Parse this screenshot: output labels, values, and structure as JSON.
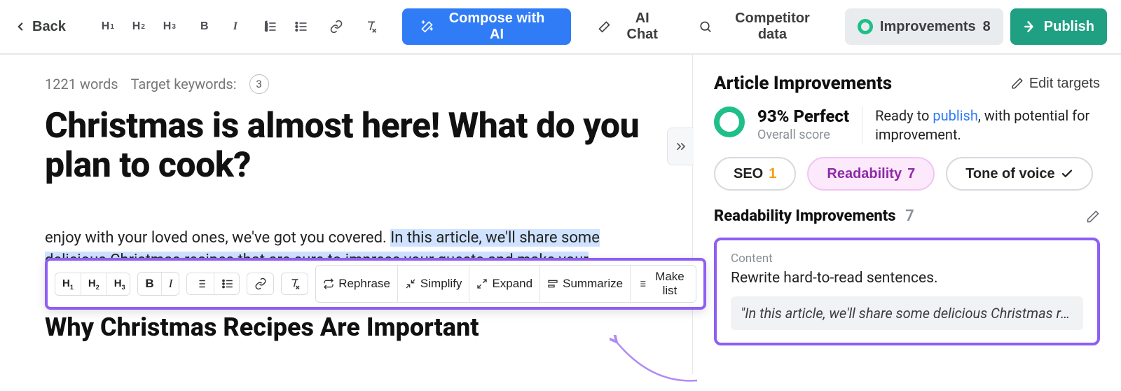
{
  "topbar": {
    "back": "Back",
    "compose": "Compose with AI",
    "ai_chat": "AI Chat",
    "competitor": "Competitor data",
    "improvements": "Improvements",
    "improvements_count": "8",
    "publish": "Publish"
  },
  "editor": {
    "words_label": "1221 words",
    "target_keywords_label": "Target keywords:",
    "target_keywords_count": "3",
    "title": "Christmas is almost here! What do you plan to cook?",
    "para_prefix": "enjoy with your loved ones, we've got you covered. ",
    "para_highlight": "In this article, we'll share some delicious Christmas recipes that are sure to impress your guests and make your holiday season even more special.",
    "h2": "Why Christmas Recipes Are Important"
  },
  "float_toolbar": {
    "rephrase": "Rephrase",
    "simplify": "Simplify",
    "expand": "Expand",
    "summarize": "Summarize",
    "make_list": "Make list"
  },
  "panel": {
    "title": "Article Improvements",
    "edit_targets": "Edit targets",
    "score_pct": "93% Perfect",
    "score_sub": "Overall score",
    "desc_prefix": "Ready to ",
    "desc_link": "publish",
    "desc_suffix": ", with potential for improvement.",
    "tabs": {
      "seo": "SEO",
      "seo_count": "1",
      "readability": "Readability",
      "readability_count": "7",
      "tone": "Tone of voice"
    },
    "section": {
      "title": "Readability Improvements",
      "count": "7"
    },
    "tip": {
      "label": "Content",
      "text": "Rewrite hard-to-read sentences.",
      "quote": "\"In this article, we'll share some delicious Christmas re…"
    }
  }
}
